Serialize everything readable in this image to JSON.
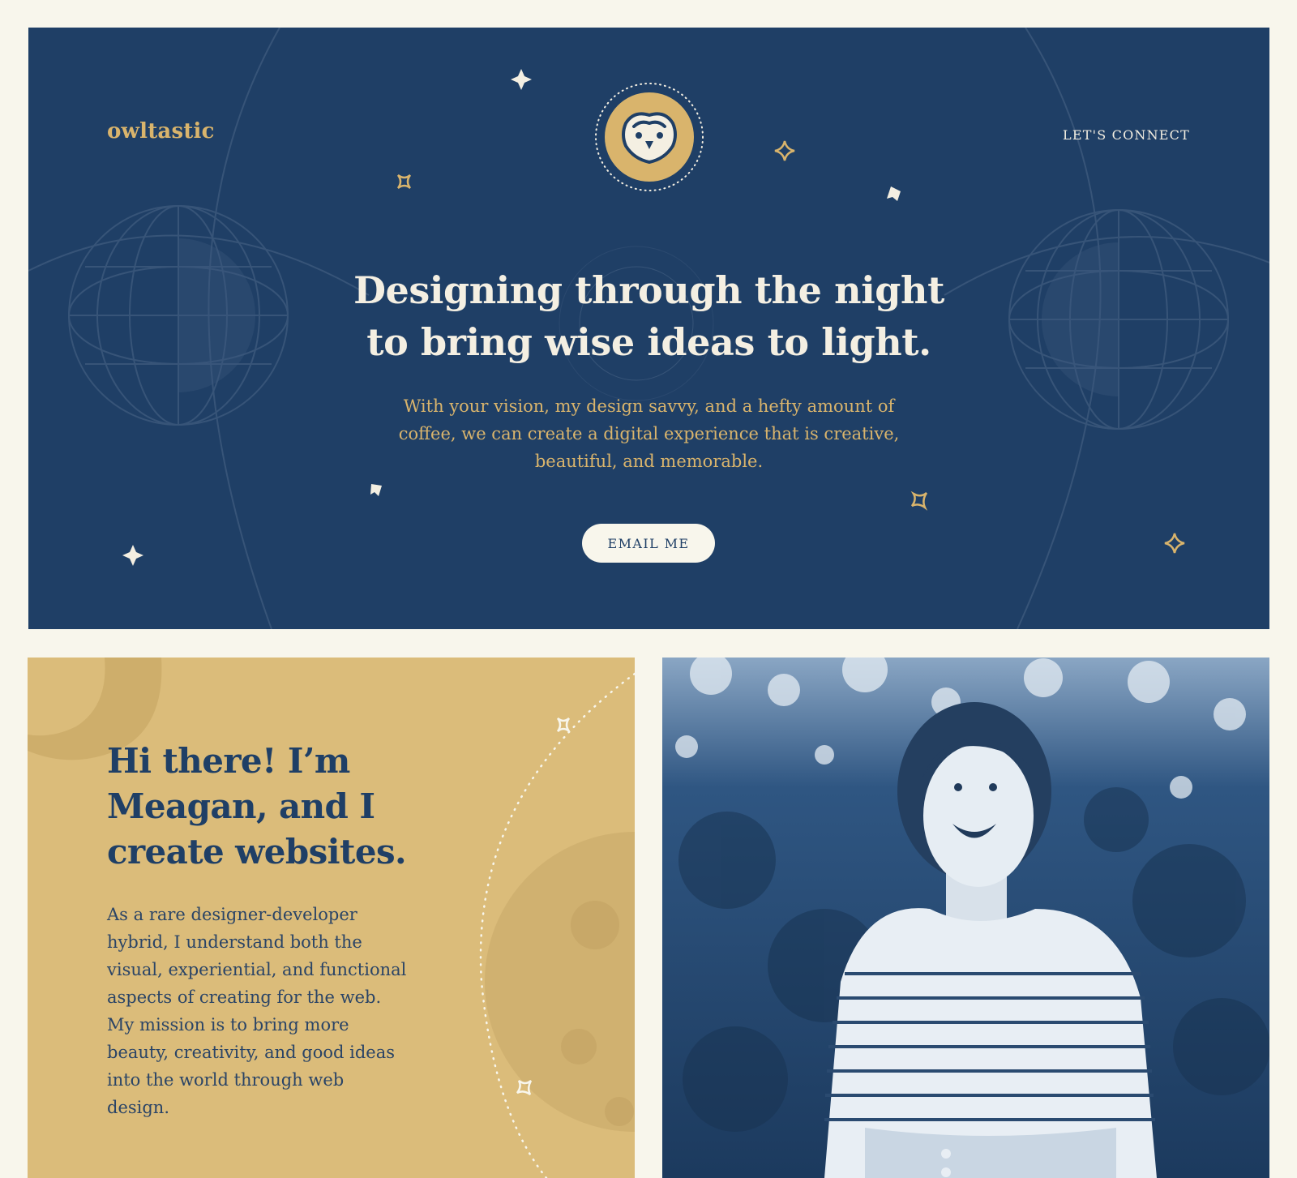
{
  "nav": {
    "brand": "owltastic",
    "connect_label": "LET'S CONNECT",
    "logo_icon": "owl-face-icon"
  },
  "hero": {
    "title": "Designing through the night to bring wise ideas to light.",
    "subtitle": "With your vision, my design savvy, and a hefty amount of coffee, we can create a digital experience that is creative, beautiful, and memorable.",
    "button_label": "EMAIL ME"
  },
  "about": {
    "title": "Hi there! I’m Meagan, and I create websites.",
    "body": "As a rare designer-developer hybrid, I understand both the visual, experiential, and functional aspects of creating for the web. My mission is to bring more beauty, creativity, and good ideas into the world through web design."
  },
  "colors": {
    "background": "#f8f6ec",
    "navy": "#1f3f66",
    "gold": "#d9b46c",
    "mustard": "#dbbc7a",
    "cream": "#f4efe2"
  }
}
